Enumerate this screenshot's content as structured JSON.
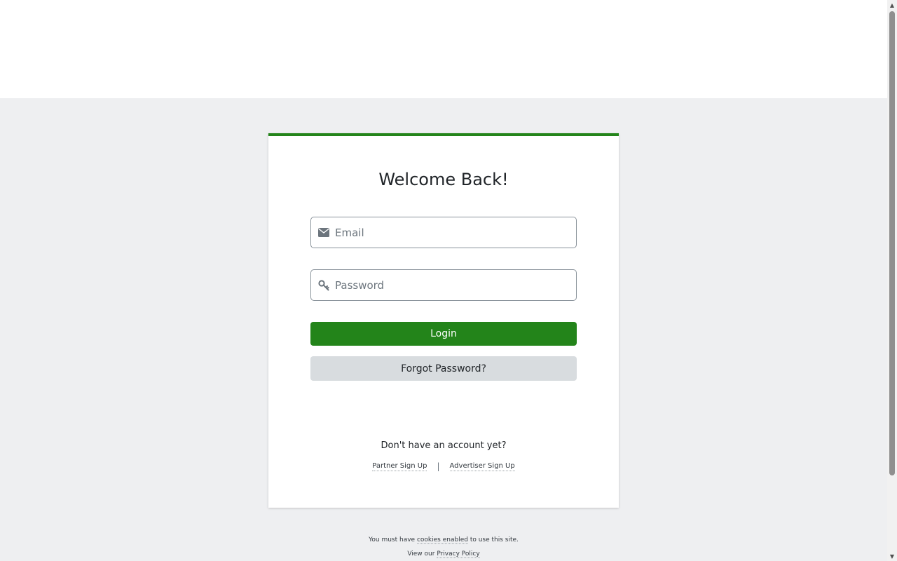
{
  "login_card": {
    "title": "Welcome Back!",
    "email": {
      "placeholder": "Email",
      "value": "",
      "icon": "envelope-icon"
    },
    "password": {
      "placeholder": "Password",
      "value": "",
      "icon": "key-icon"
    },
    "login_label": "Login",
    "forgot_label": "Forgot Password?",
    "signup_prompt": "Don't have an account yet?",
    "partner_signup": "Partner Sign Up",
    "separator": "|",
    "advertiser_signup": "Advertiser Sign Up"
  },
  "footer": {
    "cookies_prefix": "You must have",
    "cookies_link": "cookies enabled",
    "cookies_suffix": "to use this site.",
    "privacy_prefix": "View our",
    "privacy_link": "Privacy Policy"
  },
  "colors": {
    "accent": "#23841a",
    "page_background": "#eeeff1",
    "secondary_button": "#d8dcdf"
  }
}
